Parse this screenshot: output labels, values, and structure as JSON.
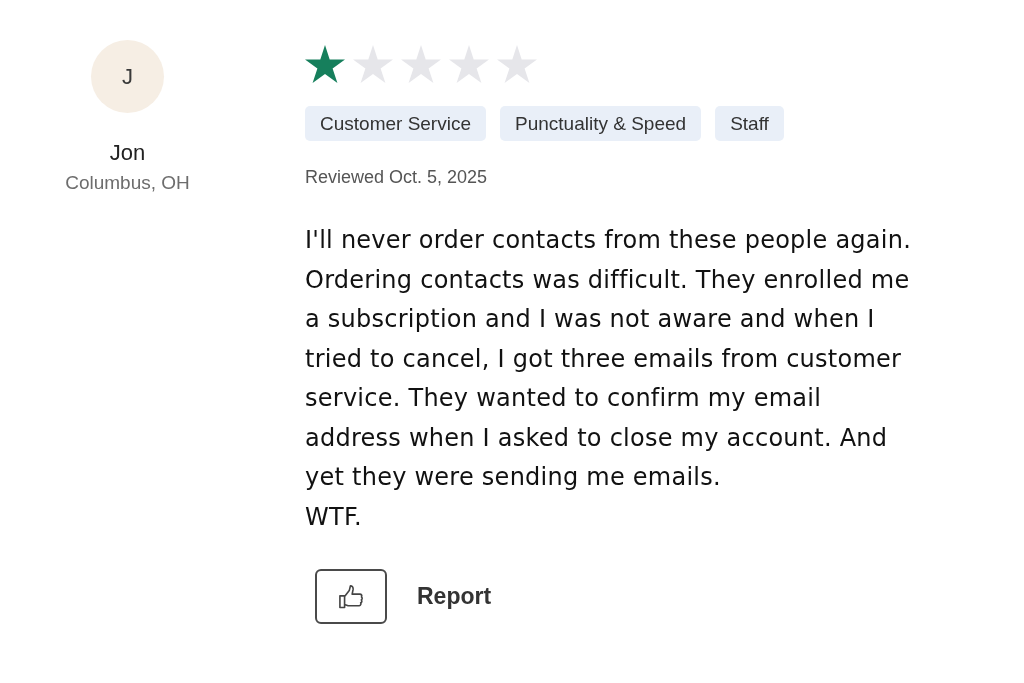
{
  "reviewer": {
    "initial": "J",
    "name": "Jon",
    "location": "Columbus, OH"
  },
  "review": {
    "stars": 1,
    "tags": [
      "Customer Service",
      "Punctuality & Speed",
      "Staff"
    ],
    "date": "Reviewed Oct. 5, 2025",
    "body": [
      "I'll never order contacts from these people again. Ordering contacts was difficult. They enrolled me a subscription and I was not aware and when I tried to cancel, I got three emails from customer service. They wanted to confirm my email address when I asked to close my account. And yet they were sending me emails.",
      "WTF."
    ]
  },
  "actions": {
    "report": "Report"
  }
}
